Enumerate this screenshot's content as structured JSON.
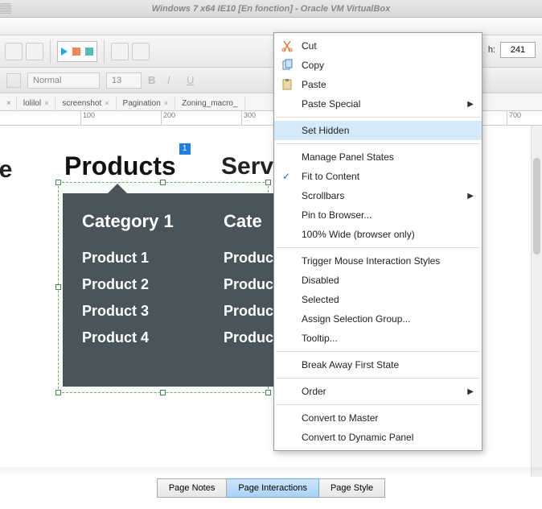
{
  "window": {
    "title": "Windows 7 x64 IE10 [En fonction] - Oracle VM VirtualBox"
  },
  "toolbar": {
    "h_label": "h:",
    "h_value": "241"
  },
  "format_toolbar": {
    "style_select": "Normal",
    "font_size": "13"
  },
  "doc_tabs": {
    "first_close": "×",
    "items": [
      "lolilol",
      "screenshot",
      "Pagination",
      "Zoning_macro_"
    ]
  },
  "ruler": {
    "ticks": [
      {
        "pos": 100,
        "label": "100"
      },
      {
        "pos": 200,
        "label": "200"
      },
      {
        "pos": 300,
        "label": "300"
      },
      {
        "pos": 700,
        "label": "700"
      }
    ]
  },
  "canvas": {
    "nav_home_partial": "me",
    "nav_products": "Products",
    "nav_products_badge": "1",
    "nav_services_partial": "Serv",
    "mega": {
      "col1": {
        "header": "Category 1",
        "items": [
          "Product 1",
          "Product 2",
          "Product 3",
          "Product 4"
        ]
      },
      "col2": {
        "header_partial": "Cate",
        "items_partial": [
          "Produc",
          "Produc",
          "Produc",
          "Produc"
        ]
      }
    }
  },
  "context_menu": {
    "cut": "Cut",
    "copy": "Copy",
    "paste": "Paste",
    "paste_special": "Paste Special",
    "set_hidden": "Set Hidden",
    "manage_panel_states": "Manage Panel States",
    "fit_to_content": "Fit to Content",
    "scrollbars": "Scrollbars",
    "pin_to_browser": "Pin to Browser...",
    "hundred_wide": "100% Wide (browser only)",
    "trigger_mouse": "Trigger Mouse Interaction Styles",
    "disabled": "Disabled",
    "selected": "Selected",
    "assign_selection_group": "Assign Selection Group...",
    "tooltip": "Tooltip...",
    "break_away": "Break Away First State",
    "order": "Order",
    "convert_to_master": "Convert to Master",
    "convert_to_dynamic_panel": "Convert to Dynamic Panel"
  },
  "bottom_tabs": {
    "page_notes": "Page Notes",
    "page_interactions": "Page Interactions",
    "page_style": "Page Style"
  }
}
